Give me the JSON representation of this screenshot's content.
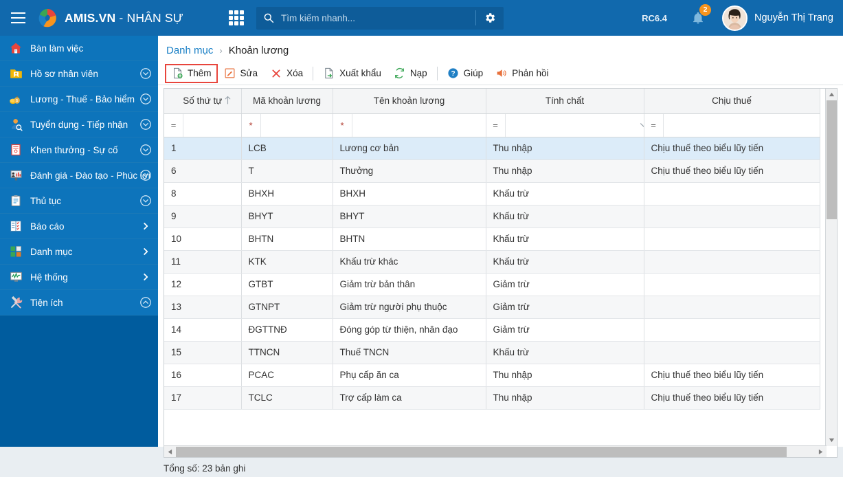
{
  "header": {
    "brand_prefix": "AMIS.VN",
    "brand_suffix": " - NHÂN SỰ",
    "menu_icon": "hamburger-icon",
    "apps_icon": "app-grid-icon",
    "search_placeholder": "Tìm kiếm nhanh...",
    "search_value": "",
    "search_icon": "search-icon",
    "settings_icon": "gear-icon",
    "version": "RC6.4",
    "bell_icon": "bell-icon",
    "notification_count": "2",
    "user_name": "Nguyễn Thị Trang",
    "bg_color": "#1169ad",
    "badge_color": "#f7941e"
  },
  "sidebar": {
    "bg_color": "#005c9e",
    "item_color": "#0d74bb",
    "items": [
      {
        "label": "Bàn làm việc",
        "icon": "home-icon",
        "arrow": "none"
      },
      {
        "label": "Hồ sơ nhân viên",
        "icon": "folder-user-icon",
        "arrow": "chevron-down-circle"
      },
      {
        "label": "Lương - Thuế - Bảo hiểm",
        "icon": "money-bag-icon",
        "arrow": "chevron-down-circle"
      },
      {
        "label": "Tuyển dụng - Tiếp nhận",
        "icon": "user-search-icon",
        "arrow": "chevron-down-circle"
      },
      {
        "label": "Khen thưởng - Sự cố",
        "icon": "certificate-icon",
        "arrow": "chevron-down-circle"
      },
      {
        "label": "Đánh giá - Đào tạo - Phúc lợi",
        "icon": "presentation-icon",
        "arrow": "chevron-down-circle"
      },
      {
        "label": "Thủ tục",
        "icon": "clipboard-icon",
        "arrow": "chevron-down-circle"
      },
      {
        "label": "Báo cáo",
        "icon": "report-icon",
        "arrow": "chevron-right"
      },
      {
        "label": "Danh mục",
        "icon": "category-icon",
        "arrow": "chevron-right"
      },
      {
        "label": "Hệ thống",
        "icon": "monitor-icon",
        "arrow": "chevron-right"
      },
      {
        "label": "Tiện ích",
        "icon": "tools-icon",
        "arrow": "chevron-up-circle"
      }
    ]
  },
  "breadcrumb": {
    "parent": "Danh mục",
    "separator": "›",
    "current": "Khoản lương"
  },
  "toolbar": {
    "add_label": "Thêm",
    "add_icon": "add-document-icon",
    "edit_label": "Sửa",
    "edit_icon": "pencil-icon",
    "delete_label": "Xóa",
    "delete_icon": "close-x-icon",
    "export_label": "Xuất khẩu",
    "export_icon": "export-document-icon",
    "reload_label": "Nạp",
    "reload_icon": "refresh-icon",
    "help_label": "Giúp",
    "help_icon": "question-circle-icon",
    "feedback_label": "Phản hồi",
    "feedback_icon": "megaphone-icon",
    "active_highlight_color": "#e8453c"
  },
  "grid": {
    "columns": [
      {
        "key": "stt",
        "label": "Số thứ tự",
        "sort": "asc",
        "filter_op": "=",
        "filter_kind": "spinner"
      },
      {
        "key": "ma",
        "label": "Mã khoản lương",
        "sort": "none",
        "filter_op": "*",
        "filter_kind": "text"
      },
      {
        "key": "ten",
        "label": "Tên khoản lương",
        "sort": "none",
        "filter_op": "*",
        "filter_kind": "text"
      },
      {
        "key": "tinh",
        "label": "Tính chất",
        "sort": "none",
        "filter_op": "=",
        "filter_kind": "dropdown"
      },
      {
        "key": "chiu",
        "label": "Chịu thuế",
        "sort": "none",
        "filter_op": "=",
        "filter_kind": "text"
      }
    ],
    "filter_values": {
      "stt": "",
      "ma": "",
      "ten": "",
      "tinh": "",
      "chiu": ""
    },
    "sort_arrow_icon": "arrow-up-icon",
    "selected_row_index": 0,
    "rows": [
      {
        "stt": "1",
        "ma": "LCB",
        "ten": "Lương cơ bản",
        "tinh": "Thu nhập",
        "chiu": "Chịu thuế theo biểu lũy tiến"
      },
      {
        "stt": "6",
        "ma": "T",
        "ten": "Thưởng",
        "tinh": "Thu nhập",
        "chiu": "Chịu thuế theo biểu lũy tiến"
      },
      {
        "stt": "8",
        "ma": "BHXH",
        "ten": "BHXH",
        "tinh": "Khấu trừ",
        "chiu": ""
      },
      {
        "stt": "9",
        "ma": "BHYT",
        "ten": "BHYT",
        "tinh": "Khấu trừ",
        "chiu": ""
      },
      {
        "stt": "10",
        "ma": "BHTN",
        "ten": "BHTN",
        "tinh": "Khấu trừ",
        "chiu": ""
      },
      {
        "stt": "11",
        "ma": "KTK",
        "ten": "Khấu trừ khác",
        "tinh": "Khấu trừ",
        "chiu": ""
      },
      {
        "stt": "12",
        "ma": "GTBT",
        "ten": "Giảm trừ bản thân",
        "tinh": "Giảm trừ",
        "chiu": ""
      },
      {
        "stt": "13",
        "ma": "GTNPT",
        "ten": "Giảm trừ người phụ thuộc",
        "tinh": "Giảm trừ",
        "chiu": ""
      },
      {
        "stt": "14",
        "ma": "ĐGTTNĐ",
        "ten": "Đóng góp từ thiện, nhân đạo",
        "tinh": "Giảm trừ",
        "chiu": ""
      },
      {
        "stt": "15",
        "ma": "TTNCN",
        "ten": "Thuế TNCN",
        "tinh": "Khấu trừ",
        "chiu": ""
      },
      {
        "stt": "16",
        "ma": "PCAC",
        "ten": "Phụ cấp ăn ca",
        "tinh": "Thu nhập",
        "chiu": "Chịu thuế theo biểu lũy tiến"
      },
      {
        "stt": "17",
        "ma": "TCLC",
        "ten": "Trợ cấp làm ca",
        "tinh": "Thu nhập",
        "chiu": "Chịu thuế theo biểu lũy tiến"
      }
    ]
  },
  "footer": {
    "total_prefix": "Tổng số: ",
    "total_count": "23",
    "total_suffix": " bản ghi",
    "total_text": "Tổng số: 23 bản ghi"
  }
}
